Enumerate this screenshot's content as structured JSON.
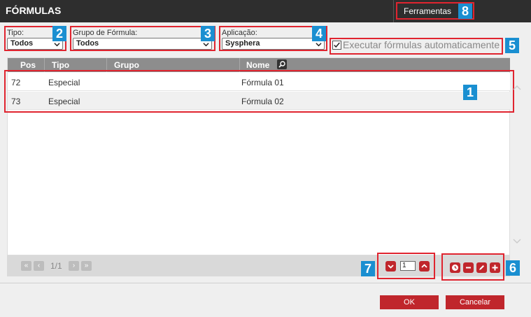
{
  "window": {
    "title": "FÓRMULAS"
  },
  "tools_tab": {
    "label": "Ferramentas"
  },
  "filters": {
    "tipo": {
      "label": "Tipo:",
      "value": "Todos"
    },
    "grupo": {
      "label": "Grupo de Fórmula:",
      "value": "Todos"
    },
    "aplicacao": {
      "label": "Aplicação:",
      "value": "Sysphera"
    },
    "auto_exec": {
      "label": "Executar fórmulas automaticamente",
      "checked": true
    }
  },
  "table": {
    "columns": [
      "Pos",
      "Tipo",
      "Grupo",
      "Nome"
    ],
    "rows": [
      {
        "pos": "72",
        "tipo": "Especial",
        "grupo": "",
        "nome": "Fórmula 01"
      },
      {
        "pos": "73",
        "tipo": "Especial",
        "grupo": "",
        "nome": "Fórmula 02"
      }
    ]
  },
  "pager": {
    "page_text": "1/1",
    "order_value": "1"
  },
  "footer": {
    "ok": "OK",
    "cancel": "Cancelar"
  },
  "callouts": [
    "1",
    "2",
    "3",
    "4",
    "5",
    "6",
    "7",
    "8"
  ],
  "colors": {
    "accent_red": "#c0262c",
    "callout_blue": "#1a8fd1",
    "title_bg": "#2e2e2e"
  }
}
